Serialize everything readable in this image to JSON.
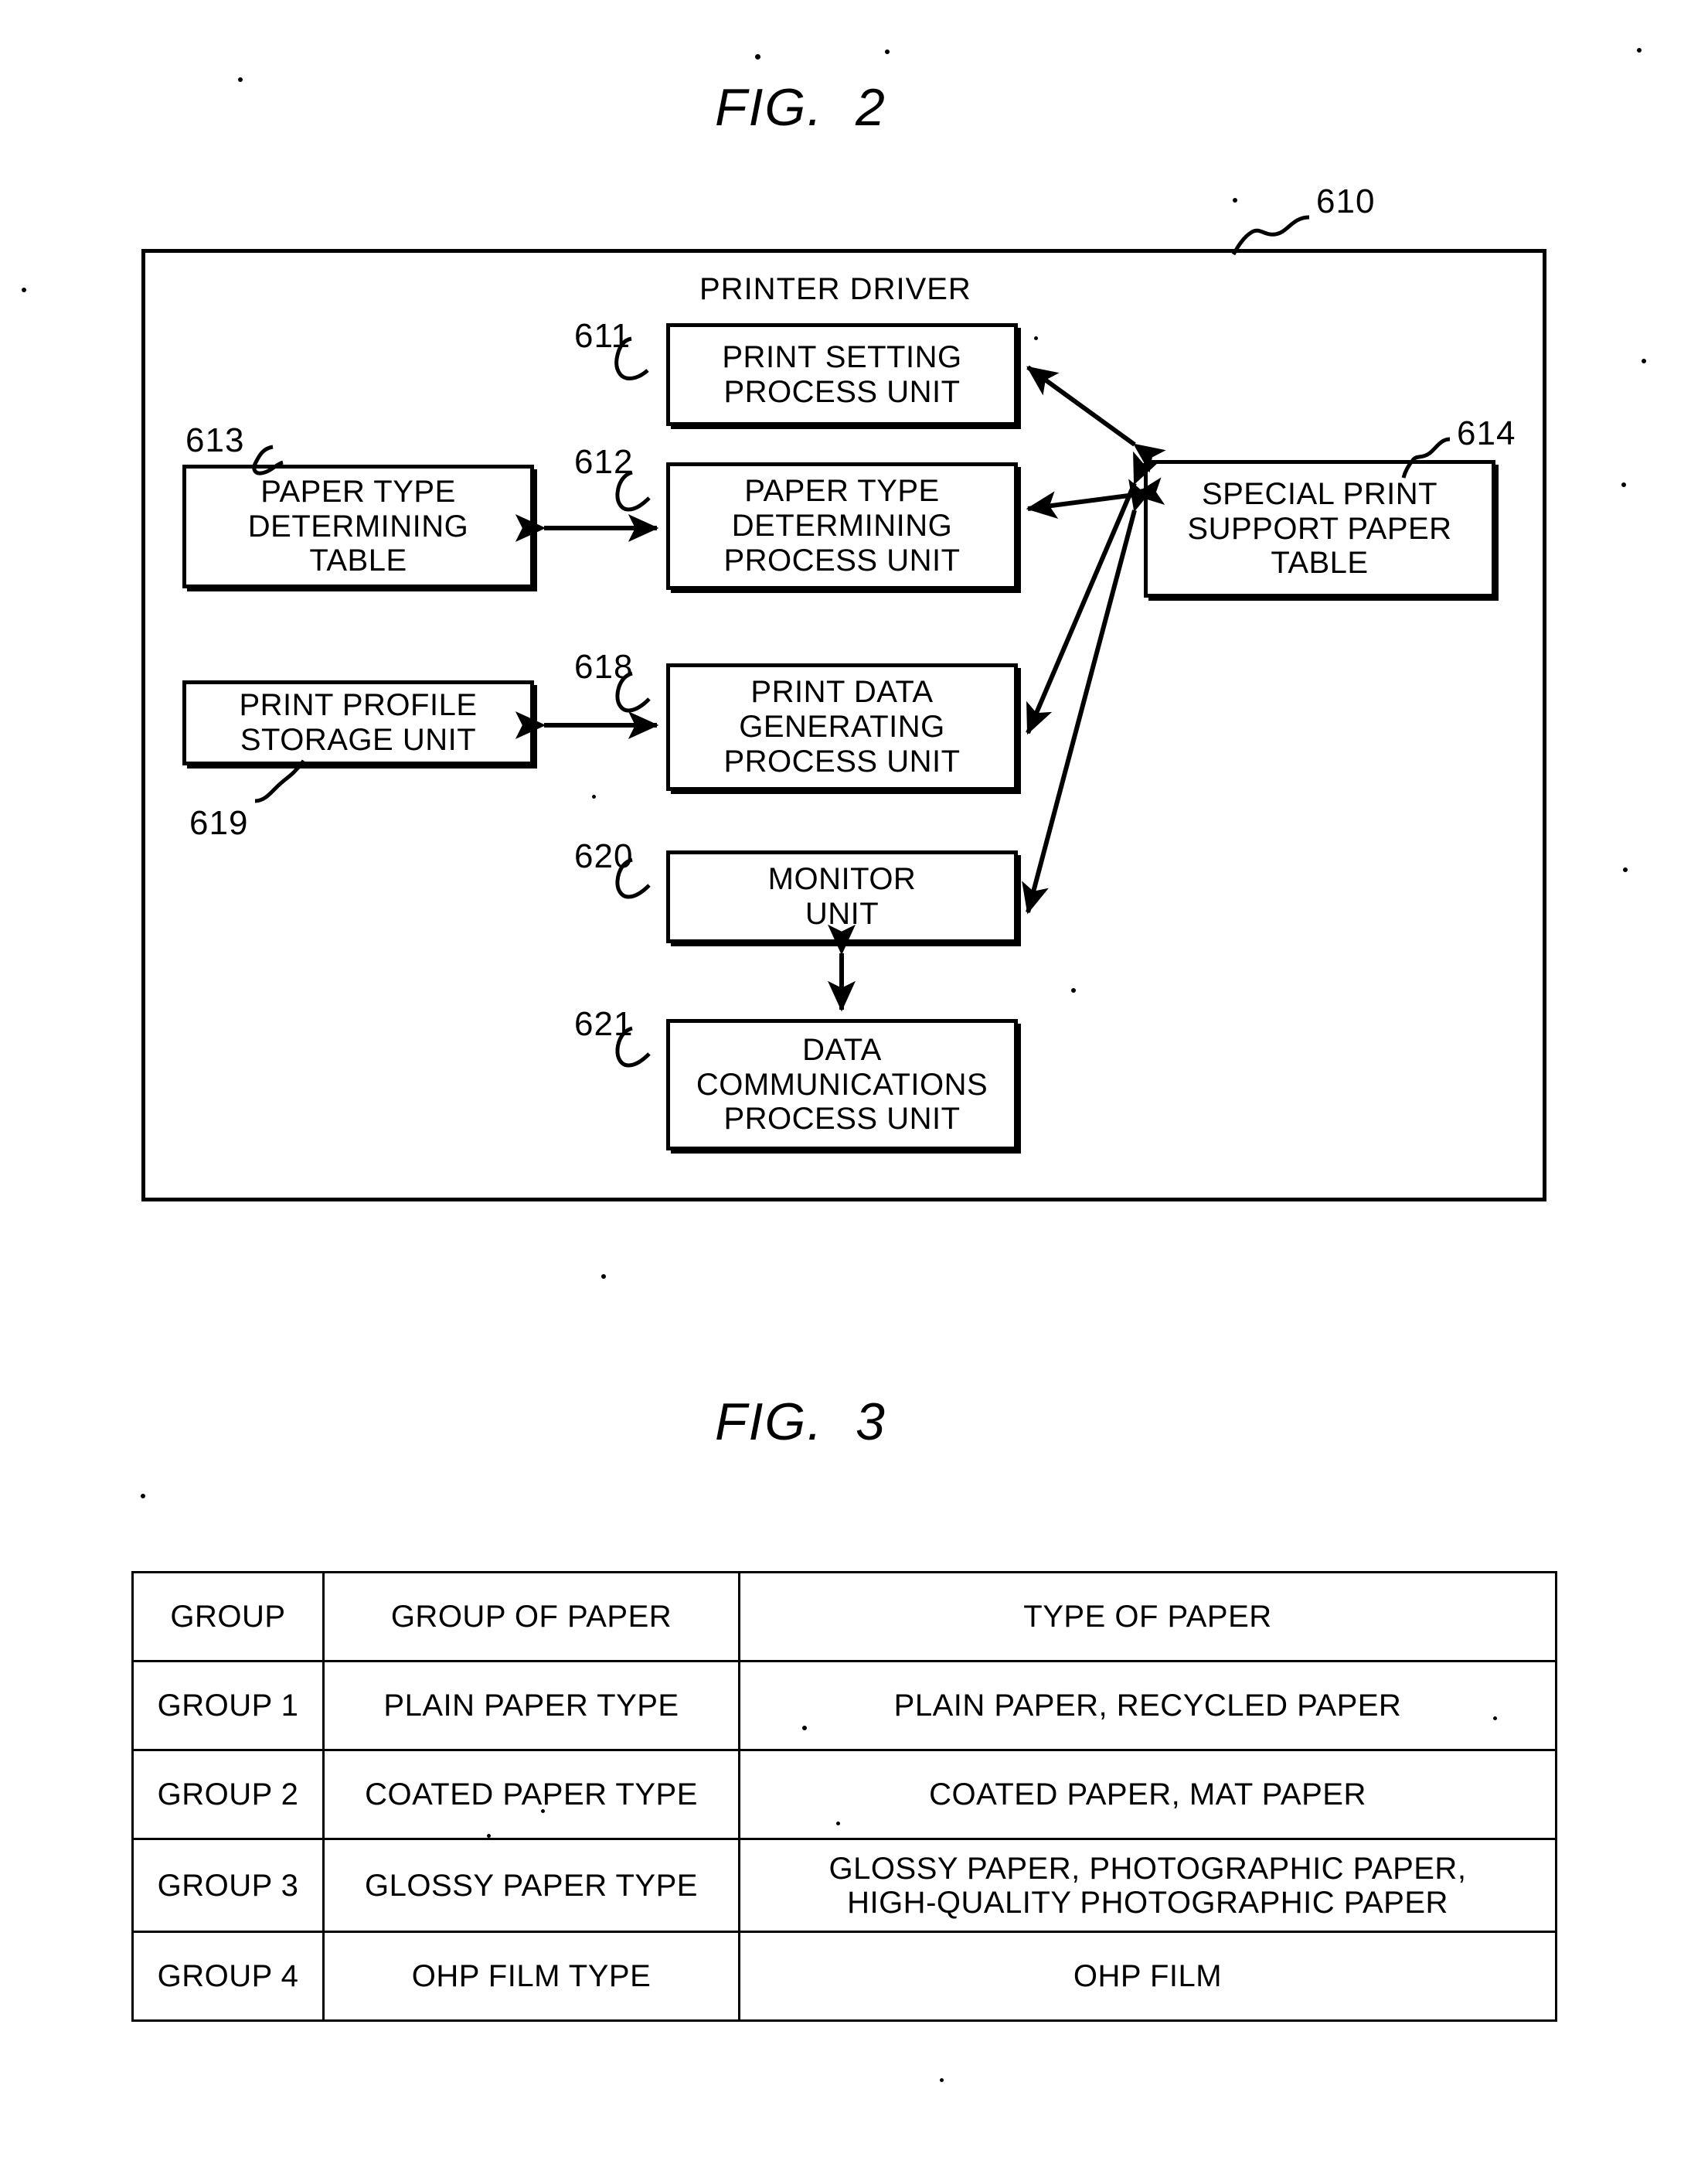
{
  "figures": [
    {
      "id": "fig2",
      "title": "FIG.  2",
      "frame_ref": "610",
      "frame_label": "PRINTER DRIVER",
      "blocks": [
        {
          "ref": "611",
          "label": "PRINT SETTING\nPROCESS UNIT"
        },
        {
          "ref": "613",
          "label": "PAPER TYPE\nDETERMINING\nTABLE"
        },
        {
          "ref": "612",
          "label": "PAPER TYPE\nDETERMINING\nPROCESS UNIT"
        },
        {
          "ref": "614",
          "label": "SPECIAL PRINT\nSUPPORT PAPER\nTABLE"
        },
        {
          "ref": "619",
          "label": "PRINT PROFILE\nSTORAGE UNIT"
        },
        {
          "ref": "618",
          "label": "PRINT DATA\nGENERATING\nPROCESS UNIT"
        },
        {
          "ref": "620",
          "label": "MONITOR\nUNIT"
        },
        {
          "ref": "621",
          "label": "DATA\nCOMMUNICATIONS\nPROCESS UNIT"
        }
      ],
      "connections": [
        {
          "from": "613",
          "to": "612",
          "style": "double-arrow"
        },
        {
          "from": "619",
          "to": "618",
          "style": "double-arrow"
        },
        {
          "from": "611",
          "to": "614",
          "style": "double-arrow"
        },
        {
          "from": "612",
          "to": "614",
          "style": "double-arrow"
        },
        {
          "from": "618",
          "to": "614",
          "style": "double-arrow"
        },
        {
          "from": "620",
          "to": "614",
          "style": "double-arrow"
        },
        {
          "from": "620",
          "to": "621",
          "style": "double-arrow"
        }
      ]
    },
    {
      "id": "fig3",
      "title": "FIG.  3"
    }
  ],
  "chart_data": {
    "type": "table",
    "title": "FIG.  3",
    "columns": [
      "GROUP",
      "GROUP OF PAPER",
      "TYPE OF PAPER"
    ],
    "rows": [
      [
        "GROUP 1",
        "PLAIN PAPER TYPE",
        "PLAIN PAPER, RECYCLED PAPER"
      ],
      [
        "GROUP 2",
        "COATED PAPER TYPE",
        "COATED PAPER, MAT PAPER"
      ],
      [
        "GROUP 3",
        "GLOSSY PAPER TYPE",
        "GLOSSY PAPER, PHOTOGRAPHIC PAPER,\nHIGH-QUALITY PHOTOGRAPHIC PAPER"
      ],
      [
        "GROUP 4",
        "OHP FILM TYPE",
        "OHP FILM"
      ]
    ]
  }
}
